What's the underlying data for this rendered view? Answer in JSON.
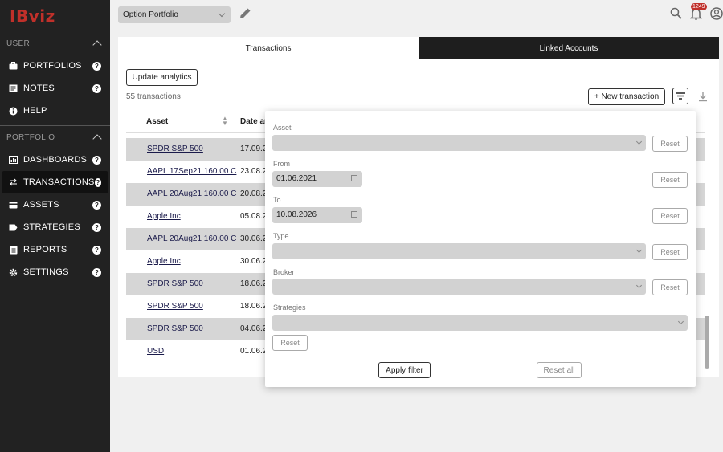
{
  "app": {
    "logo": "IBviz"
  },
  "sidebar": {
    "sections": [
      {
        "title": "USER",
        "items": [
          {
            "label": "PORTFOLIOS",
            "icon": "briefcase-icon"
          },
          {
            "label": "NOTES",
            "icon": "notes-icon"
          },
          {
            "label": "HELP",
            "icon": "info-icon"
          }
        ]
      },
      {
        "title": "PORTFOLIO",
        "items": [
          {
            "label": "DASHBOARDS",
            "icon": "dashboard-icon"
          },
          {
            "label": "TRANSACTIONS",
            "icon": "swap-icon",
            "active": true
          },
          {
            "label": "ASSETS",
            "icon": "card-icon"
          },
          {
            "label": "STRATEGIES",
            "icon": "tag-icon"
          },
          {
            "label": "REPORTS",
            "icon": "report-icon"
          },
          {
            "label": "SETTINGS",
            "icon": "gear-icon"
          }
        ]
      }
    ],
    "help_glyph": "?"
  },
  "header": {
    "portfolio": "Option Portfolio",
    "notification_count": "1249"
  },
  "tabs": [
    {
      "label": "Transactions"
    },
    {
      "label": "Linked Accounts"
    }
  ],
  "toolbar": {
    "update_label": "Update analytics",
    "count_label": "55 transactions",
    "new_label": "+ New transaction"
  },
  "table": {
    "headers": {
      "asset": "Asset",
      "date": "Date ar"
    },
    "rows": [
      {
        "asset": "SPDR S&P 500",
        "date": "17.09.2"
      },
      {
        "asset": "AAPL 17Sep21 160.00 C",
        "date": "23.08.2"
      },
      {
        "asset": "AAPL 20Aug21 160.00 C",
        "date": "20.08.20"
      },
      {
        "asset": "Apple Inc",
        "date": "05.08.2"
      },
      {
        "asset": "AAPL 20Aug21 160.00 C",
        "date": "30.06.2"
      },
      {
        "asset": "Apple Inc",
        "date": "30.06.2"
      },
      {
        "asset": "SPDR S&P 500",
        "date": "18.06.2"
      },
      {
        "asset": "SPDR S&P 500",
        "date": "18.06.2"
      },
      {
        "asset": "SPDR S&P 500",
        "date": "04.06.2"
      },
      {
        "asset": "USD",
        "date": "01.06.2"
      }
    ]
  },
  "filter": {
    "asset_label": "Asset",
    "from_label": "From",
    "from_value": "01.06.2021",
    "to_label": "To",
    "to_value": "10.08.2026",
    "type_label": "Type",
    "broker_label": "Broker",
    "strategies_label": "Strategies",
    "reset_label": "Reset",
    "apply_label": "Apply filter",
    "reset_all_label": "Reset all"
  }
}
